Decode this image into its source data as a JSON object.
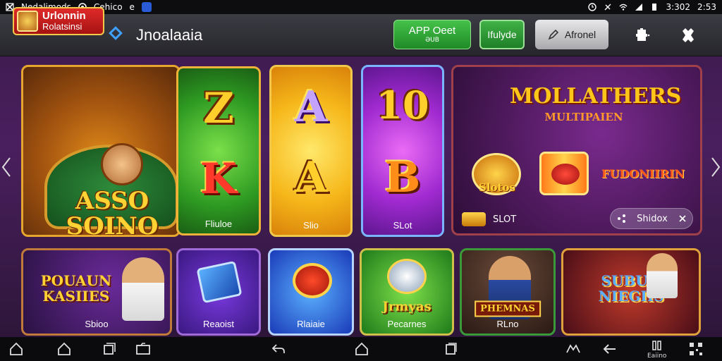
{
  "status_bar": {
    "app_name": "Nedalimods",
    "secondary": "Cehico",
    "secondary_mark": "e",
    "time_a": "3:302",
    "time_b": "2:53"
  },
  "app_bar": {
    "brand_line1": "Urlonnin",
    "brand_line2": "Rolatsinsi",
    "title": "Jnoalaaia",
    "app_button_line1": "APP Oeet",
    "app_button_line2": "ƏUB",
    "indicator_button": "Ifulyde",
    "action_button": "Afronel"
  },
  "games_top": [
    {
      "title": "ASSO SOINO",
      "label": ""
    },
    {
      "letter_top": "Z",
      "letter_bottom": "K",
      "label": "Fliuloe"
    },
    {
      "letter_top": "A",
      "letter_bottom": "A",
      "label": "Slio"
    },
    {
      "letter_top": "10",
      "letter_bottom": "B",
      "label": "SLot"
    }
  ],
  "feature_panel": {
    "title": "MOLLATHERS",
    "subtitle": "MULTIPAIEN",
    "slots_label": "Slotos",
    "promo_label": "FUDONIIRIN",
    "slot_tag": "SLOT",
    "close_label": "Shidox"
  },
  "games_bottom": [
    {
      "art": "POUAUN KASIIES",
      "label": "Sbioo"
    },
    {
      "art": "",
      "label": "Reaoist"
    },
    {
      "art": "",
      "label": "Rlaiaie"
    },
    {
      "art": "Jrmyas",
      "label": "Pecarnes"
    },
    {
      "art": "PHEMNAS",
      "label": "RLno"
    },
    {
      "art": "SUBUH NIEGIIS",
      "label": ""
    }
  ],
  "nav_bar": {
    "right_label": "Eaiino"
  },
  "colors": {
    "accent_green": "#2e9a22",
    "accent_gold": "#ffce2a",
    "background": "#3a1a4a"
  }
}
